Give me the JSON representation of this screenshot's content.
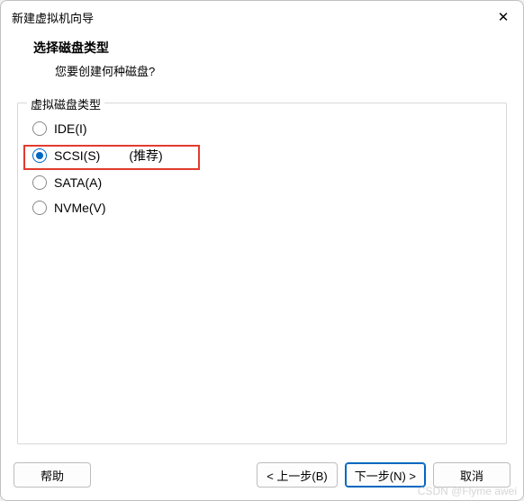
{
  "titlebar": {
    "title": "新建虚拟机向导",
    "close": "✕"
  },
  "header": {
    "title": "选择磁盘类型",
    "subtitle": "您要创建何种磁盘?"
  },
  "group": {
    "legend": "虚拟磁盘类型"
  },
  "options": {
    "ide": "IDE(I)",
    "scsi": "SCSI(S)",
    "scsi_recommend": "(推荐)",
    "sata": "SATA(A)",
    "nvme": "NVMe(V)"
  },
  "buttons": {
    "help": "帮助",
    "back": "< 上一步(B)",
    "next": "下一步(N) >",
    "cancel": "取消"
  },
  "watermark": "CSDN @Flyme awei"
}
